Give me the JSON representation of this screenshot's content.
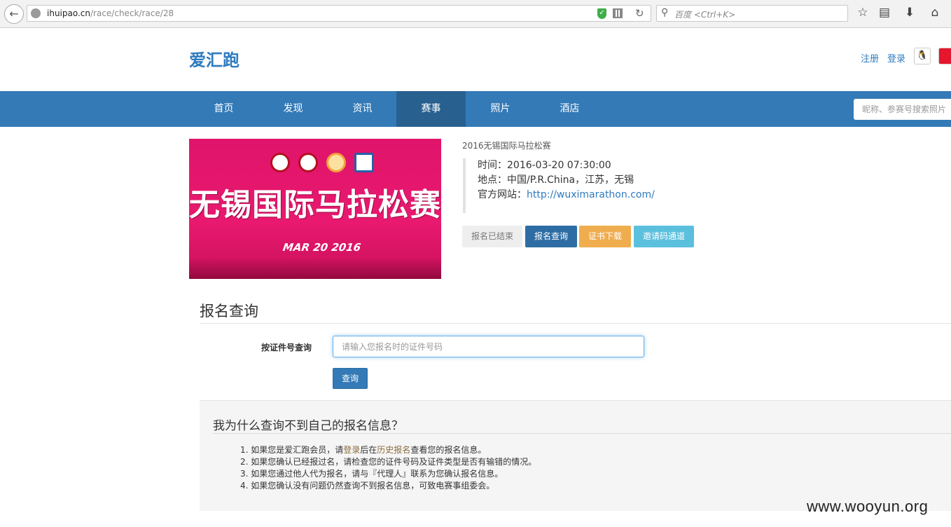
{
  "browser": {
    "url_host": "ihuipao.cn",
    "url_path": "/race/check/race/28",
    "search_placeholder": "百度 <Ctrl+K>",
    "icons": [
      "back-icon",
      "globe-icon",
      "shield-icon",
      "qr-icon",
      "reload-icon",
      "search-icon",
      "star-icon",
      "reading-list-icon",
      "download-icon",
      "home-icon"
    ]
  },
  "header": {
    "logo": "爱汇跑",
    "register": "注册",
    "login": "登录",
    "social_icons": [
      "qq-icon",
      "weibo-icon"
    ]
  },
  "nav": {
    "items": [
      {
        "label": "首页"
      },
      {
        "label": "发现"
      },
      {
        "label": "资讯"
      },
      {
        "label": "赛事",
        "active": true
      },
      {
        "label": "照片"
      },
      {
        "label": "酒店"
      }
    ],
    "search_placeholder": "昵称、参赛号搜索照片"
  },
  "race": {
    "banner_title": "无锡国际马拉松赛",
    "banner_date": "MAR 20 2016",
    "name": "2016无锡国际马拉松赛",
    "time_label": "时间：",
    "time": "2016-03-20 07:30:00",
    "place_label": "地点：",
    "place": "中国/P.R.China，江苏，无锡",
    "site_label": "官方网站：",
    "site": "http://wuximarathon.com/",
    "buttons": {
      "ended": "报名已结束",
      "query": "报名查询",
      "cert": "证书下载",
      "invite": "邀请码通道"
    }
  },
  "form": {
    "title": "报名查询",
    "field_label": "按证件号查询",
    "id_placeholder": "请输入您报名时的证件号码",
    "id_value": "",
    "submit": "查询"
  },
  "help": {
    "title": "我为什么查询不到自己的报名信息？",
    "item1_pre": "1. 如果您是爱汇跑会员，请",
    "item1_login": "登录",
    "item1_mid": "后在",
    "item1_history": "历史报名",
    "item1_post": "查看您的报名信息。",
    "item2": "2. 如果您确认已经报过名，请检查您的证件号码及证件类型是否有输错的情况。",
    "item3": "3. 如果您通过他人代为报名，请与『代理人』联系为您确认报名信息。",
    "item4": "4. 如果您确认没有问题仍然查询不到报名信息，可致电赛事组委会。"
  },
  "watermark": "www.wooyun.org"
}
